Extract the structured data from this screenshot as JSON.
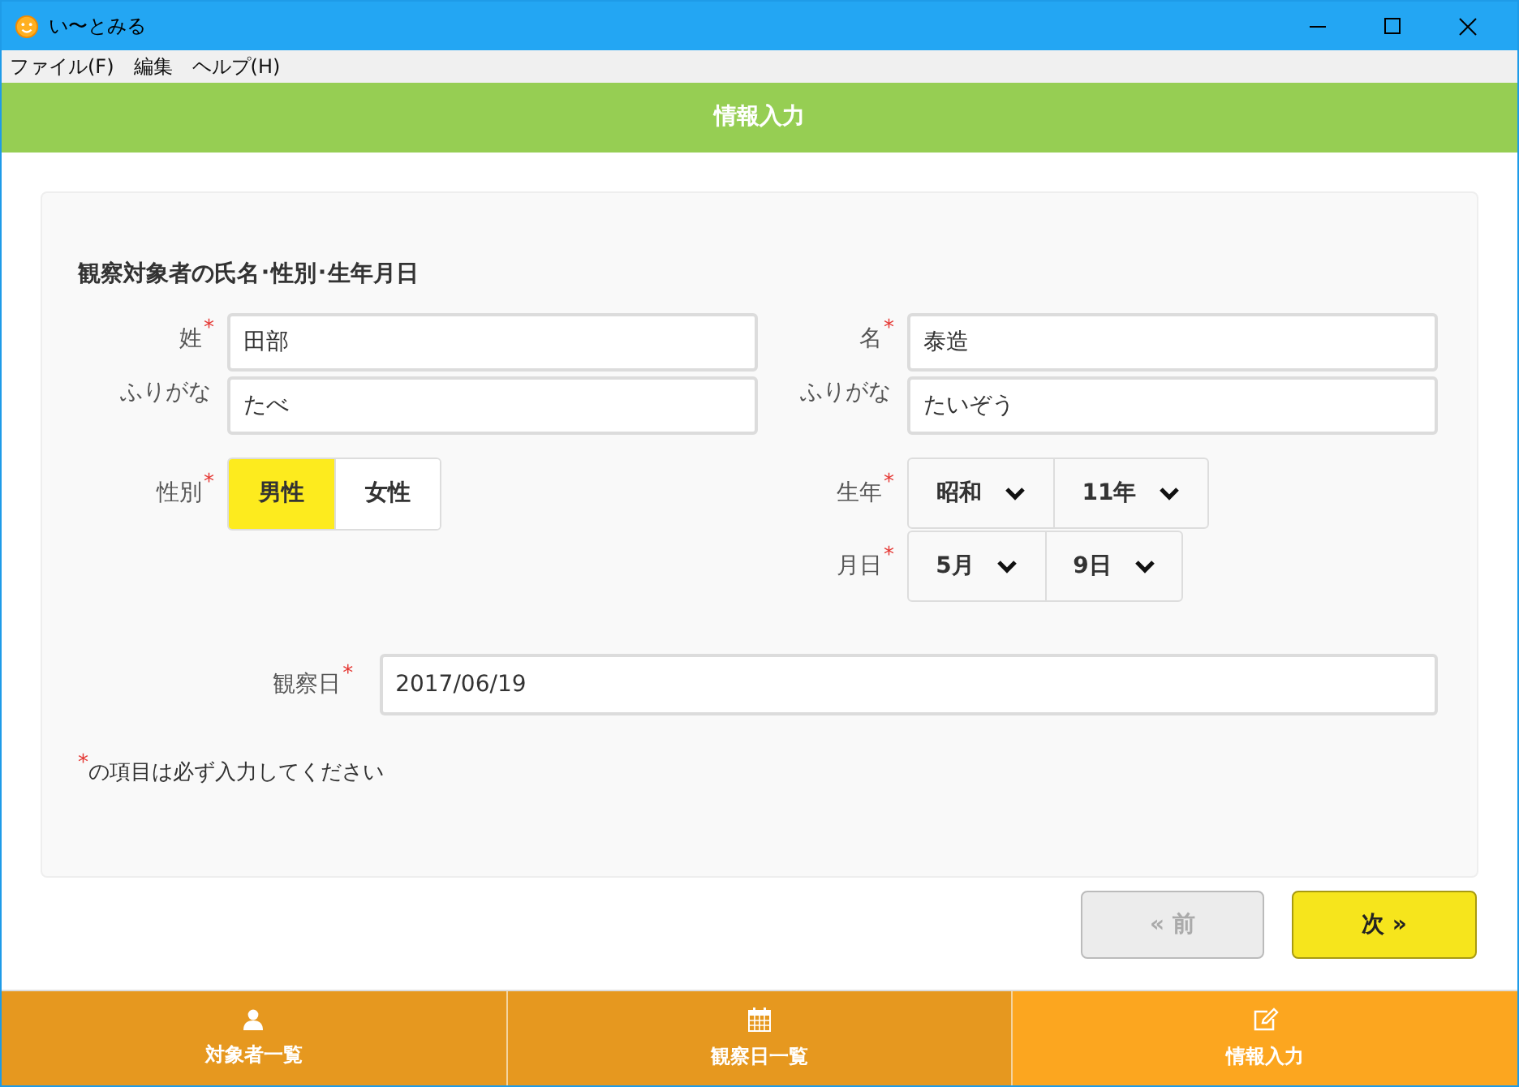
{
  "window": {
    "title": "い〜とみる"
  },
  "menu": [
    "ファイル(F)",
    "編集",
    "ヘルプ(H)"
  ],
  "header": {
    "title": "情報入力"
  },
  "form": {
    "section_title": "観察対象者の氏名･性別･生年月日",
    "last_name": {
      "label": "姓",
      "required_mark": "*",
      "value": "田部",
      "kana_label": "ふりがな",
      "kana_value": "たべ"
    },
    "first_name": {
      "label": "名",
      "required_mark": "*",
      "value": "泰造",
      "kana_label": "ふりがな",
      "kana_value": "たいぞう"
    },
    "gender": {
      "label": "性別",
      "required_mark": "*",
      "options": [
        {
          "label": "男性",
          "selected": true
        },
        {
          "label": "女性",
          "selected": false
        }
      ]
    },
    "birth_year": {
      "label": "生年",
      "required_mark": "*",
      "selects": [
        "昭和",
        "11年"
      ]
    },
    "birth_day": {
      "label": "月日",
      "required_mark": "*",
      "selects": [
        "5月",
        "9日"
      ]
    },
    "observation_date": {
      "label": "観察日",
      "required_mark": "*",
      "value": "2017/06/19"
    },
    "note": {
      "mark": "*",
      "text": "の項目は必ず入力してください"
    }
  },
  "buttons": [
    {
      "label": "« 前",
      "kind": "prev",
      "disabled": true
    },
    {
      "label": "次 »",
      "kind": "next",
      "disabled": false
    }
  ],
  "nav": [
    {
      "label": "対象者一覧",
      "kind": "person",
      "selected": false
    },
    {
      "label": "観察日一覧",
      "kind": "calendar",
      "selected": false
    },
    {
      "label": "情報入力",
      "kind": "edit",
      "selected": true
    }
  ]
}
